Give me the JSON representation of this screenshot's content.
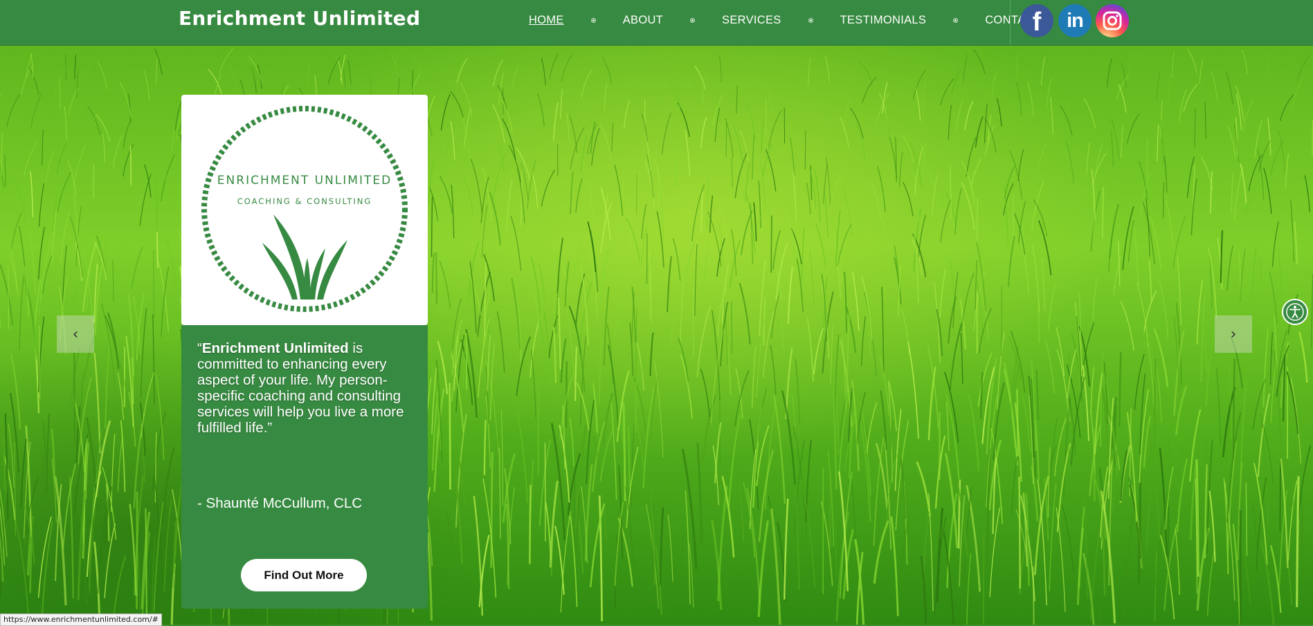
{
  "header": {
    "brand": "Enrichment Unlimited",
    "nav": [
      {
        "label": "HOME",
        "active": true
      },
      {
        "label": "ABOUT"
      },
      {
        "label": "SERVICES"
      },
      {
        "label": "TESTIMONIALS"
      },
      {
        "label": "CONTACT"
      }
    ],
    "social": [
      {
        "name": "facebook-icon",
        "glyph": "f"
      },
      {
        "name": "linkedin-icon",
        "glyph": "in"
      },
      {
        "name": "instagram-icon"
      }
    ]
  },
  "logo": {
    "line1": "ENRICHMENT UNLIMITED",
    "line2": "COACHING & CONSULTING"
  },
  "card": {
    "quote_open": "“",
    "quote_bold": "Enrichment Unlimited",
    "quote_rest": " is committed to enhancing every aspect of your life. My person-specific coaching and consulting services will help you live a more fulfilled life.”",
    "author": "- Shaunté McCullum, CLC",
    "cta_label": "Find Out More"
  },
  "slider": {
    "prev_glyph": "‹",
    "next_glyph": "›"
  },
  "status_url": "https://www.enrichmentunlimited.com/#",
  "colors": {
    "brand_green": "#378a41",
    "white": "#ffffff"
  }
}
